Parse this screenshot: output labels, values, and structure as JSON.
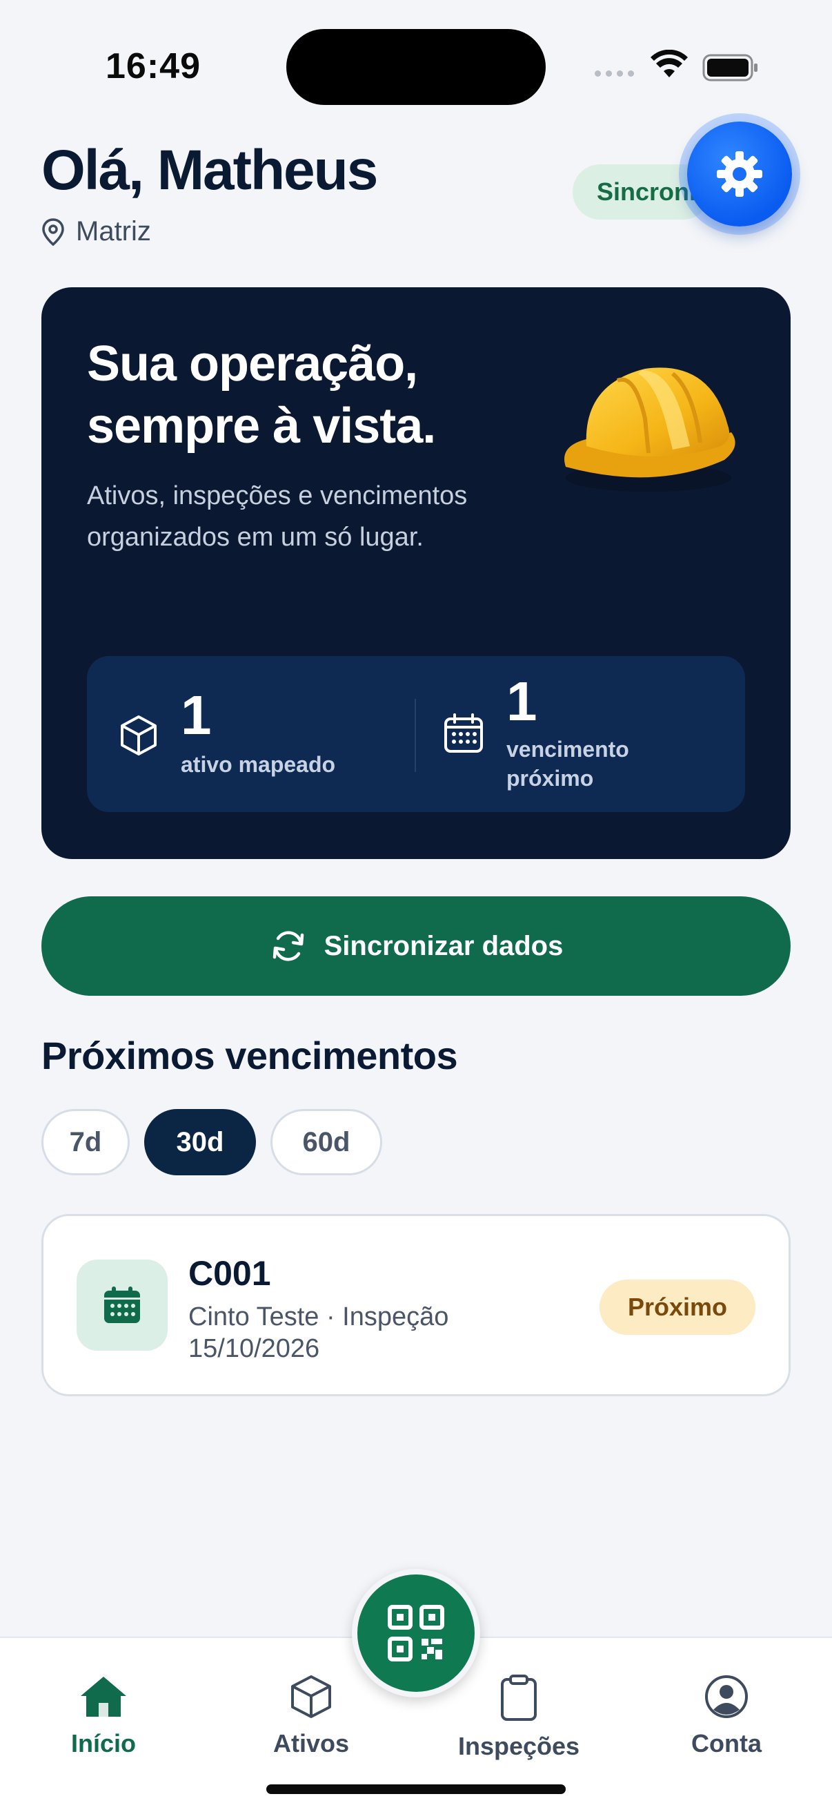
{
  "status_bar": {
    "time": "16:49"
  },
  "header": {
    "greeting": "Olá, Matheus",
    "location": "Matriz",
    "sync_status": "Sincroni"
  },
  "hero": {
    "title": "Sua operação, sempre à vista.",
    "subtitle": "Ativos, inspeções e vencimentos organizados em um só lugar.",
    "stats": [
      {
        "icon": "cube-icon",
        "value": "1",
        "label": "ativo mapeado"
      },
      {
        "icon": "calendar-icon",
        "value": "1",
        "label": "vencimento próximo"
      }
    ]
  },
  "sync_button": {
    "label": "Sincronizar dados"
  },
  "upcoming": {
    "title": "Próximos vencimentos",
    "filters": [
      {
        "label": "7d",
        "active": false
      },
      {
        "label": "30d",
        "active": true
      },
      {
        "label": "60d",
        "active": false
      }
    ],
    "items": [
      {
        "code": "C001",
        "description": "Cinto Teste · Inspeção",
        "date": "15/10/2026",
        "badge": "Próximo"
      }
    ]
  },
  "bottom_nav": {
    "items": [
      {
        "label": "Início",
        "icon": "home-icon",
        "active": true
      },
      {
        "label": "Ativos",
        "icon": "cube-icon",
        "active": false
      },
      {
        "label": "Inspeções",
        "icon": "clipboard-icon",
        "active": false
      },
      {
        "label": "Conta",
        "icon": "user-circle-icon",
        "active": false
      }
    ],
    "fab_icon": "qr-code-icon"
  },
  "colors": {
    "primary_green": "#0f6b4b",
    "navy": "#0b1832",
    "accent_blue": "#0a5cf0",
    "badge_bg": "#fcebc3"
  }
}
